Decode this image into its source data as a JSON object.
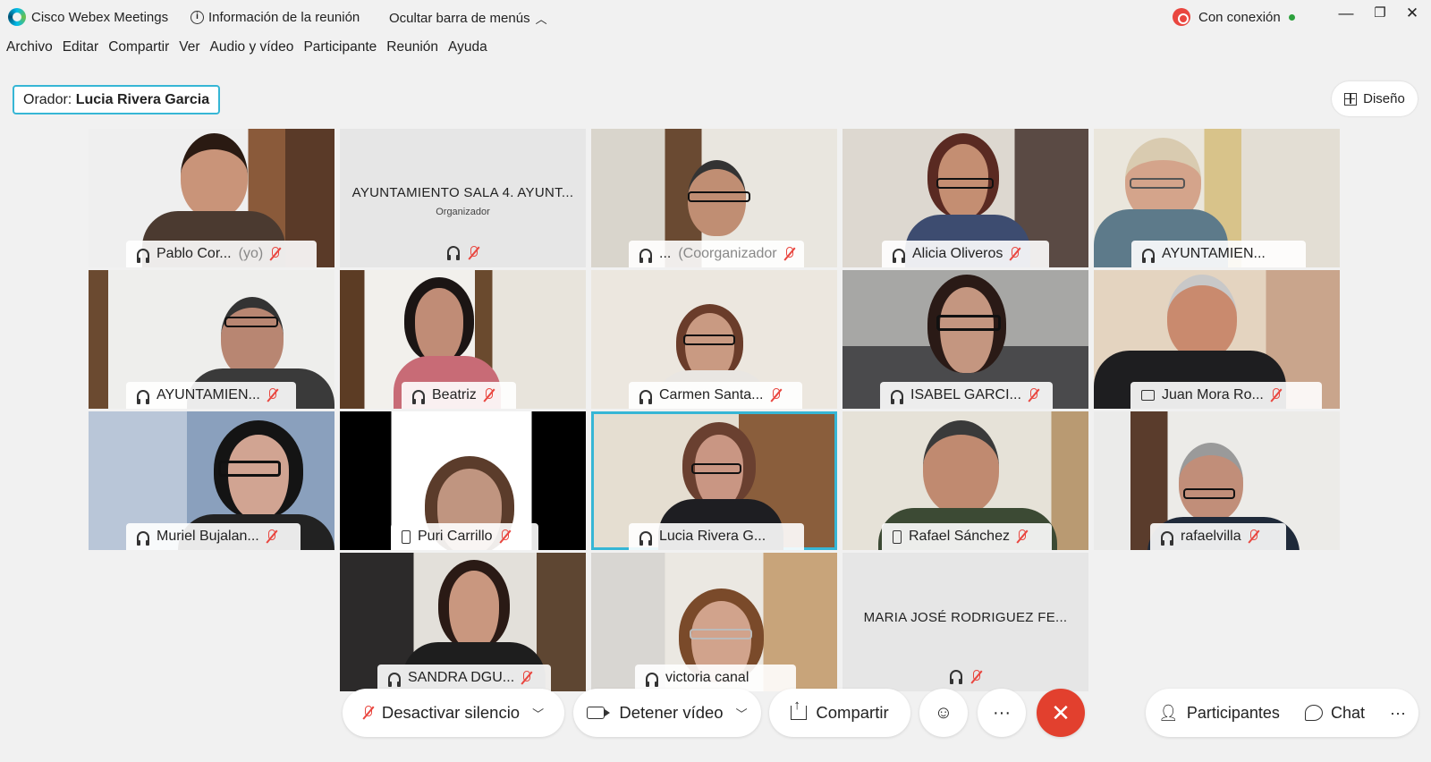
{
  "titlebar": {
    "app_title": "Cisco Webex Meetings",
    "meeting_info": "Información de la reunión",
    "hide_menu": "Ocultar barra de menús",
    "connection": "Con conexión",
    "accent_color": "#36b6d5",
    "recording_color": "#e9463f",
    "status_color": "#2ca03c"
  },
  "menu": [
    "Archivo",
    "Editar",
    "Compartir",
    "Ver",
    "Audio y vídeo",
    "Participante",
    "Reunión",
    "Ayuda"
  ],
  "speaker": {
    "prefix": "Orador:",
    "name": "Lucia Rivera Garcia"
  },
  "layout_button": "Diseño",
  "tiles": [
    {
      "name": "Pablo Cor...",
      "sub": "(yo)",
      "icon": "headset-icon"
    },
    {
      "name": "AYUNTAMIENTO SALA 4. AYUNT...",
      "sub": "Organizador",
      "icon": "headset-icon"
    },
    {
      "name": "...",
      "sub": "(Coorganizador",
      "icon": "headset-icon"
    },
    {
      "name": "Alicia Oliveros",
      "sub": "",
      "icon": "headset-icon"
    },
    {
      "name": "AYUNTAMIEN...",
      "sub": "",
      "icon": "headset-icon"
    },
    {
      "name": "AYUNTAMIEN...",
      "sub": "",
      "icon": "headset-icon"
    },
    {
      "name": "Beatriz",
      "sub": "",
      "icon": "headset-icon"
    },
    {
      "name": "Carmen Santa...",
      "sub": "",
      "icon": "headset-icon"
    },
    {
      "name": "ISABEL GARCI...",
      "sub": "",
      "icon": "headset-icon"
    },
    {
      "name": "Juan Mora Ro...",
      "sub": "",
      "icon": "screen-icon"
    },
    {
      "name": "Muriel Bujalan...",
      "sub": "",
      "icon": "headset-icon"
    },
    {
      "name": "Puri Carrillo",
      "sub": "",
      "icon": "phone-icon"
    },
    {
      "name": "Lucia Rivera G...",
      "sub": "",
      "icon": "headset-icon"
    },
    {
      "name": "Rafael Sánchez",
      "sub": "",
      "icon": "phone-icon"
    },
    {
      "name": "rafaelvilla",
      "sub": "",
      "icon": "headset-icon"
    },
    {
      "name": "SANDRA DGU...",
      "sub": "",
      "icon": "headset-icon"
    },
    {
      "name": "victoria canal",
      "sub": "",
      "icon": "headset-icon"
    },
    {
      "name": "MARIA JOSÉ RODRIGUEZ FE...",
      "sub": "",
      "icon": "headset-icon"
    }
  ],
  "controls": {
    "mute": "Desactivar silencio",
    "video": "Detener vídeo",
    "share": "Compartir",
    "more": "···",
    "end": "✕",
    "participants": "Participantes",
    "chat": "Chat",
    "more_right": "···"
  }
}
